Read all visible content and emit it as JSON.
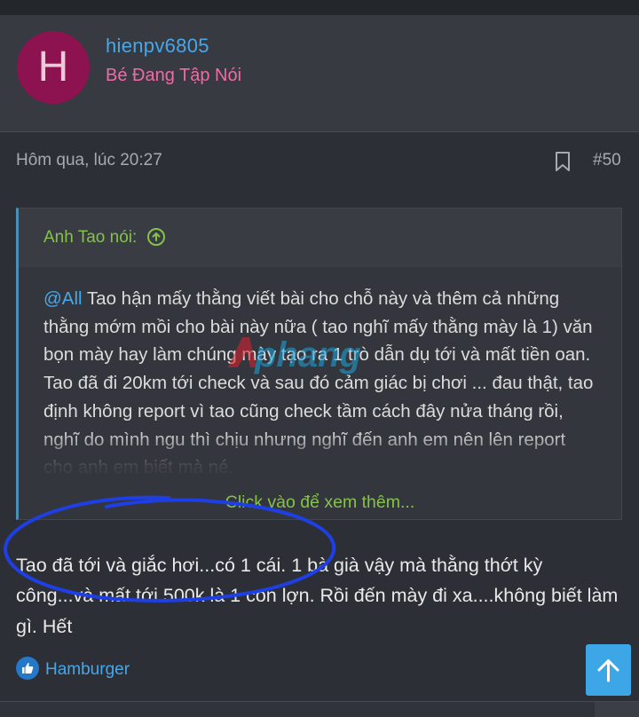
{
  "post": {
    "user": {
      "avatar_letter": "H",
      "username": "hienpv6805",
      "title": "Bé Đang Tập Nói"
    },
    "timestamp": "Hôm qua, lúc 20:27",
    "post_number": "#50",
    "quote": {
      "author_label": "Anh Tao nói:",
      "mention": "@All",
      "text": " Tao hận mấy thằng viết bài cho chỗ này và thêm cả những thằng mớm mồi cho bài này nữa ( tao nghĩ mấy thằng mày là 1) văn bọn mày hay làm chúng mày tạo ra 1 trò dẫn dụ tới và mất tiền oan. Tao đã đi 20km tới check và sau đó cảm giác bị chơi ... đau thật, tao định không report vì tao cũng check tầm cách đây nửa tháng rồi, nghĩ do mình ngu thì chịu nhưng nghĩ đến anh em nên lên report cho anh em biết mà né.",
      "expand_label": "Click vào để xem thêm..."
    },
    "body": "Tao đã tới và giắc hơi...có 1 cái. 1 bà già vậy mà thằng thớt kỳ công...và mất tới 500k là 1 con lợn. Rồi đến mày đi xa....không biết làm gì. Hết",
    "reaction": {
      "user": "Hamburger"
    }
  },
  "watermark": "phang",
  "colors": {
    "background": "#2c2f35",
    "link": "#47a7eb",
    "user_title": "#f06aa8",
    "quote_accent": "#86c14c",
    "scroll_button": "#3da6e6",
    "annotation_circle": "#1f3fe6"
  }
}
